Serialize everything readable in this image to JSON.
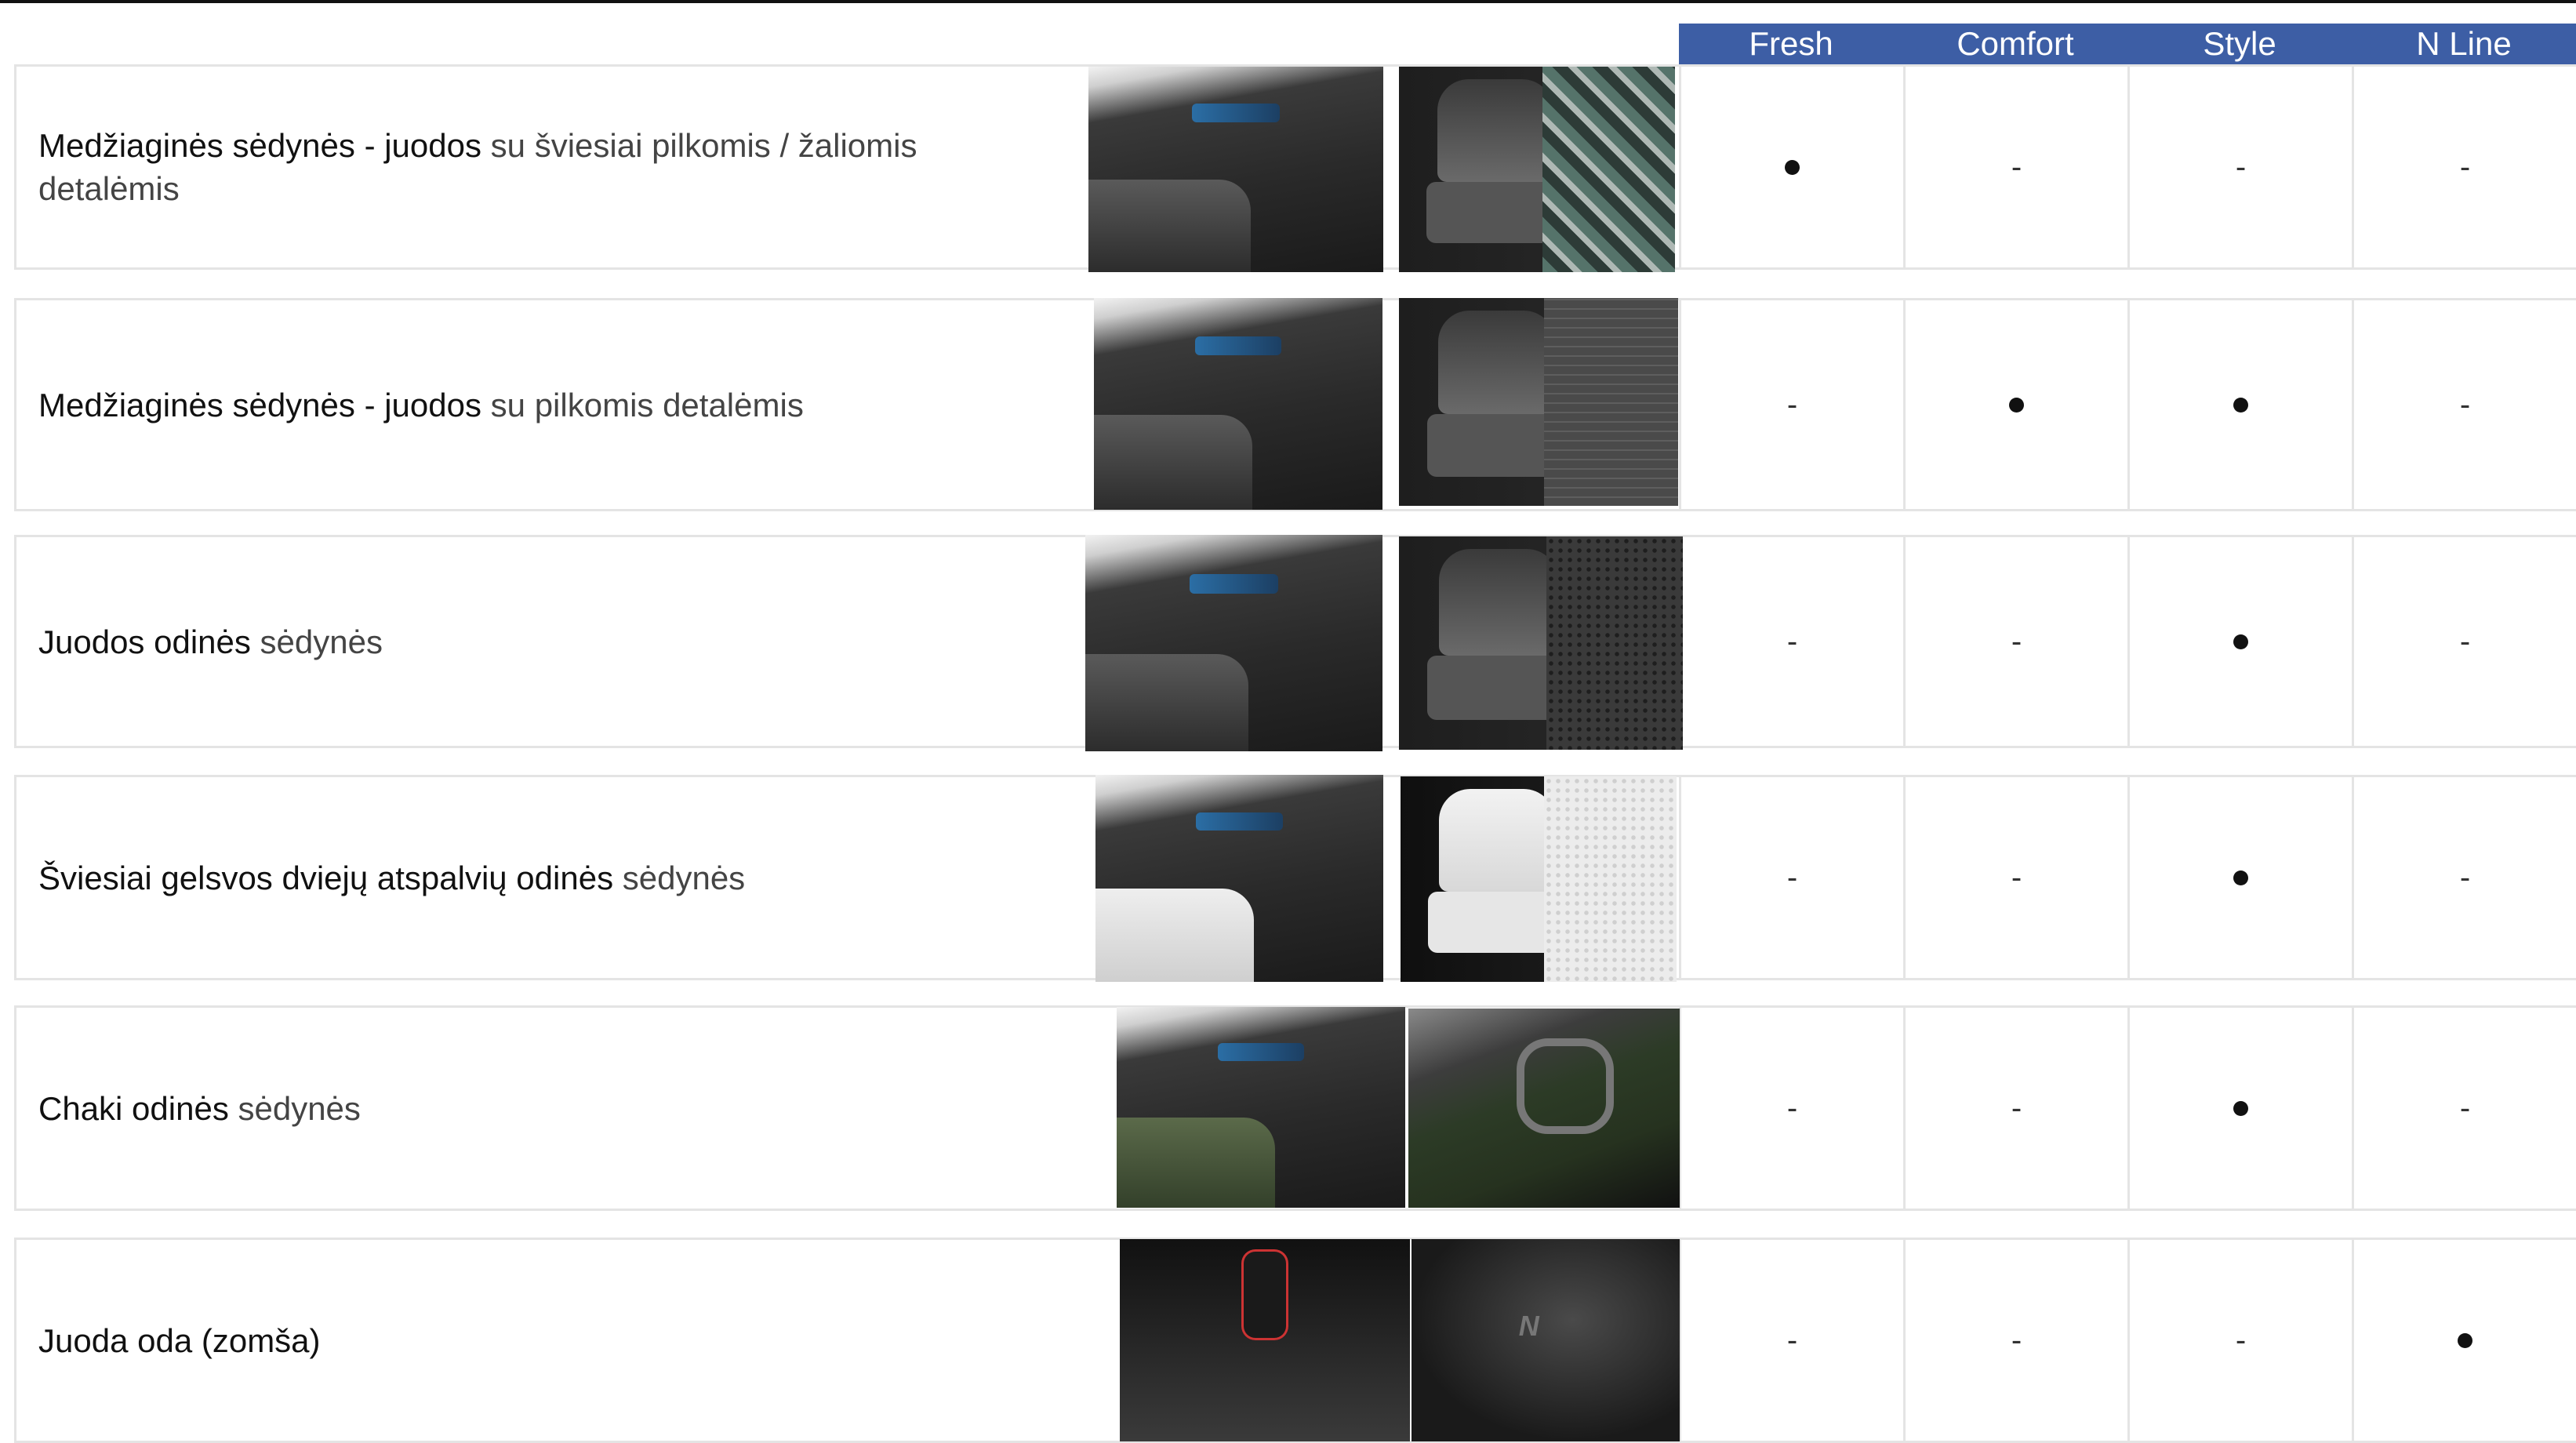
{
  "columns": [
    "Fresh",
    "Comfort",
    "Style",
    "N Line"
  ],
  "rows": [
    {
      "label_bold": "Medžiaginės sėdynės - juodos",
      "label_light": "su šviesiai pilkomis / žaliomis",
      "label_line2": "detalėmis",
      "cells": [
        "●",
        "-",
        "-",
        "-"
      ],
      "photo_1": "interior-dashboard-photo",
      "photo_2": "seat-green-fabric-photo"
    },
    {
      "label_bold": "Medžiaginės sėdynės - juodos",
      "label_light": "su pilkomis detalėmis",
      "label_line2": "",
      "cells": [
        "-",
        "●",
        "●",
        "-"
      ],
      "photo_1": "interior-dashboard-photo",
      "photo_2": "seat-grey-fabric-photo"
    },
    {
      "label_bold": "Juodos odinės",
      "label_light": "sėdynės",
      "label_line2": "",
      "cells": [
        "-",
        "-",
        "●",
        "-"
      ],
      "photo_1": "interior-dashboard-photo",
      "photo_2": "seat-black-leather-photo"
    },
    {
      "label_bold": "Šviesiai gelsvos dviejų atspalvių odinės",
      "label_light": "sėdynės",
      "label_line2": "",
      "cells": [
        "-",
        "-",
        "●",
        "-"
      ],
      "photo_1": "interior-dashboard-photo",
      "photo_2": "seat-light-leather-photo"
    },
    {
      "label_bold": "Chaki odinės",
      "label_light": "sėdynės",
      "label_line2": "",
      "cells": [
        "-",
        "-",
        "●",
        "-"
      ],
      "photo_1": "interior-dashboard-photo",
      "photo_2": "door-khaki-photo"
    },
    {
      "label_bold": "Juoda oda (zomša)",
      "label_light": "",
      "label_line2": "",
      "cells": [
        "-",
        "-",
        "-",
        "●"
      ],
      "photo_1": "gear-shifter-photo",
      "photo_2": "n-line-seat-photo"
    }
  ],
  "colors": {
    "header_bg": "#3d5ea5",
    "header_text": "#ffffff",
    "border": "#e4e4e4"
  }
}
